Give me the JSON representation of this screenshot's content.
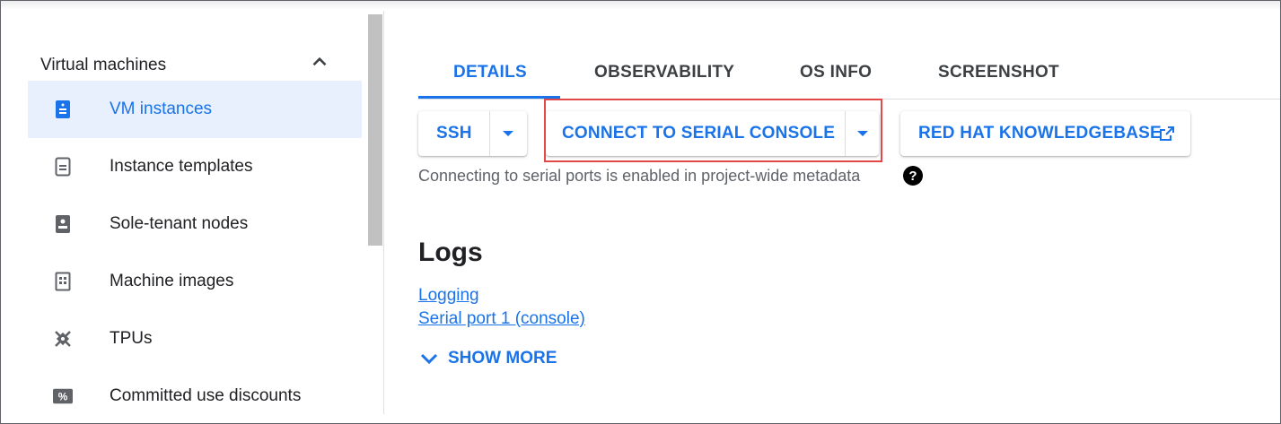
{
  "sidebar": {
    "group_label": "Virtual machines",
    "items": [
      {
        "label": "VM instances",
        "icon": "vm-instance-icon",
        "active": true
      },
      {
        "label": "Instance templates",
        "icon": "instance-template-icon",
        "active": false
      },
      {
        "label": "Sole-tenant nodes",
        "icon": "sole-tenant-node-icon",
        "active": false
      },
      {
        "label": "Machine images",
        "icon": "machine-image-icon",
        "active": false
      },
      {
        "label": "TPUs",
        "icon": "tpu-icon",
        "active": false
      },
      {
        "label": "Committed use discounts",
        "icon": "percent-discount-icon",
        "active": false
      }
    ]
  },
  "tabs": [
    {
      "label": "DETAILS",
      "active": true
    },
    {
      "label": "OBSERVABILITY",
      "active": false
    },
    {
      "label": "OS INFO",
      "active": false
    },
    {
      "label": "SCREENSHOT",
      "active": false
    }
  ],
  "toolbar": {
    "ssh_label": "SSH",
    "serial_console_label": "CONNECT TO SERIAL CONSOLE",
    "knowledgebase_label": "RED HAT KNOWLEDGEBASE"
  },
  "serial_note": "Connecting to serial ports is enabled in project-wide metadata",
  "logs": {
    "heading": "Logs",
    "links": [
      "Logging",
      "Serial port 1 (console)"
    ],
    "show_more_label": "SHOW MORE"
  },
  "colors": {
    "accent": "#1a73e8",
    "active_bg": "#e8f0fe",
    "highlight_border": "#e34848"
  }
}
